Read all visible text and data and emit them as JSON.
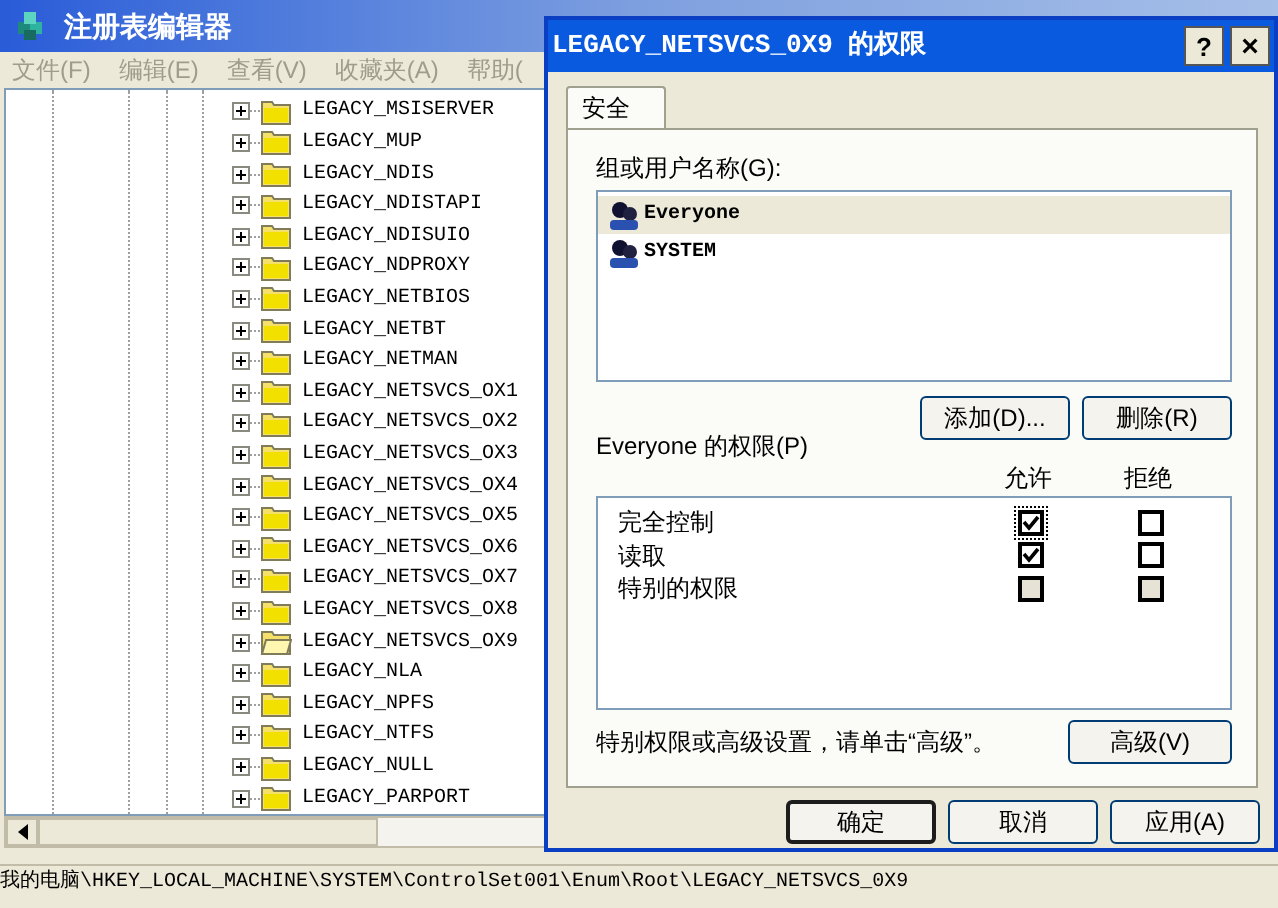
{
  "window": {
    "title": "注册表编辑器"
  },
  "menu": [
    "文件(F)",
    "编辑(E)",
    "查看(V)",
    "收藏夹(A)",
    "帮助("
  ],
  "tree": [
    {
      "label": "LEGACY_MSISERVER",
      "selected": false
    },
    {
      "label": "LEGACY_MUP",
      "selected": false
    },
    {
      "label": "LEGACY_NDIS",
      "selected": false
    },
    {
      "label": "LEGACY_NDISTAPI",
      "selected": false
    },
    {
      "label": "LEGACY_NDISUIO",
      "selected": false
    },
    {
      "label": "LEGACY_NDPROXY",
      "selected": false
    },
    {
      "label": "LEGACY_NETBIOS",
      "selected": false
    },
    {
      "label": "LEGACY_NETBT",
      "selected": false
    },
    {
      "label": "LEGACY_NETMAN",
      "selected": false
    },
    {
      "label": "LEGACY_NETSVCS_OX1",
      "selected": false
    },
    {
      "label": "LEGACY_NETSVCS_OX2",
      "selected": false
    },
    {
      "label": "LEGACY_NETSVCS_OX3",
      "selected": false
    },
    {
      "label": "LEGACY_NETSVCS_OX4",
      "selected": false
    },
    {
      "label": "LEGACY_NETSVCS_OX5",
      "selected": false
    },
    {
      "label": "LEGACY_NETSVCS_OX6",
      "selected": false
    },
    {
      "label": "LEGACY_NETSVCS_OX7",
      "selected": false
    },
    {
      "label": "LEGACY_NETSVCS_OX8",
      "selected": false
    },
    {
      "label": "LEGACY_NETSVCS_OX9",
      "selected": true
    },
    {
      "label": "LEGACY_NLA",
      "selected": false
    },
    {
      "label": "LEGACY_NPFS",
      "selected": false
    },
    {
      "label": "LEGACY_NTFS",
      "selected": false
    },
    {
      "label": "LEGACY_NULL",
      "selected": false
    },
    {
      "label": "LEGACY_PARPORT",
      "selected": false
    }
  ],
  "status_bar": "我的电脑\\HKEY_LOCAL_MACHINE\\SYSTEM\\ControlSet001\\Enum\\Root\\LEGACY_NETSVCS_0X9",
  "dialog": {
    "title": "LEGACY_NETSVCS_0X9 的权限",
    "help": "?",
    "close": "×",
    "tabs": [
      {
        "label": "安全",
        "selected": true
      }
    ],
    "users_label": "组或用户名称(G):",
    "users": [
      {
        "name": "Everyone",
        "selected": true
      },
      {
        "name": "SYSTEM",
        "selected": false
      }
    ],
    "add_button": "添加(D)...",
    "remove_button": "删除(R)",
    "permissions_label": "Everyone 的权限(P)",
    "columns": [
      "允许",
      "拒绝"
    ],
    "permissions": [
      {
        "name": "完全控制",
        "allow": true,
        "deny": false,
        "disabled": false
      },
      {
        "name": "读取",
        "allow": true,
        "deny": false,
        "disabled": false
      },
      {
        "name": "特别的权限",
        "allow": false,
        "deny": false,
        "disabled": true
      }
    ],
    "advanced_hint": "特别权限或高级设置，请单击“高级”。",
    "advanced_button": "高级(V)",
    "buttons": [
      {
        "label": "确定",
        "default": true
      },
      {
        "label": "取消",
        "default": false
      },
      {
        "label": "应用(A)",
        "default": false
      }
    ]
  }
}
